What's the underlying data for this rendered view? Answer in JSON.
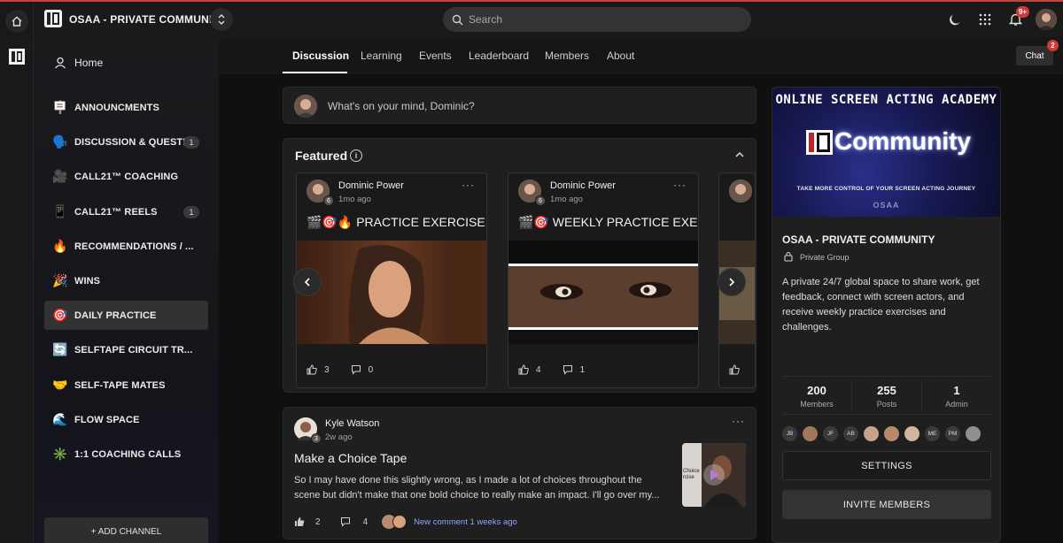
{
  "topbar": {
    "community_name": "OSAA - PRIVATE COMMUNITY",
    "search_placeholder": "Search",
    "notifications_badge": "9+",
    "chat_badge": "2"
  },
  "sidebar": {
    "home_label": "Home",
    "items": [
      {
        "emoji": "🪧",
        "label": "ANNOUNCMENTS",
        "count": ""
      },
      {
        "emoji": "🗣️",
        "label": "DISCUSSION & QUESTI...",
        "count": "1"
      },
      {
        "emoji": "🎥",
        "label": "CALL21™ COACHING",
        "count": ""
      },
      {
        "emoji": "📱",
        "label": "CALL21™ REELS",
        "count": "1"
      },
      {
        "emoji": "🔥",
        "label": "RECOMMENDATIONS / ...",
        "count": ""
      },
      {
        "emoji": "🎉",
        "label": "WINS",
        "count": ""
      },
      {
        "emoji": "🎯",
        "label": "DAILY PRACTICE",
        "count": ""
      },
      {
        "emoji": "🔄",
        "label": "SELFTAPE CIRCUIT TR...",
        "count": ""
      },
      {
        "emoji": "🤝",
        "label": "SELF-TAPE MATES",
        "count": ""
      },
      {
        "emoji": "🌊",
        "label": "FLOW SPACE",
        "count": ""
      },
      {
        "emoji": "✳️",
        "label": "1:1 COACHING CALLS",
        "count": ""
      }
    ],
    "add_channel": "+ ADD CHANNEL"
  },
  "tabs": [
    "Discussion",
    "Learning",
    "Events",
    "Leaderboard",
    "Members",
    "About"
  ],
  "chat_label": "Chat",
  "composer": {
    "placeholder": "What's on your mind, Dominic?"
  },
  "featured": {
    "title": "Featured",
    "posts": [
      {
        "author": "Dominic Power",
        "level": "6",
        "when": "1mo ago",
        "title_prefix": "🎬🎯🔥",
        "title": "PRACTICE EXERCISE",
        "likes": "3",
        "comments": "0"
      },
      {
        "author": "Dominic Power",
        "level": "6",
        "when": "1mo ago",
        "title_prefix": "🎬🎯",
        "title": "WEEKLY PRACTICE EXE...",
        "likes": "4",
        "comments": "1"
      }
    ]
  },
  "about": {
    "banner_heading": "ONLINE SCREEN ACTING ACADEMY",
    "banner_brand": "Community",
    "banner_tagline": "TAKE MORE CONTROL OF YOUR SCREEN ACTING JOURNEY",
    "banner_footer": "OSAA",
    "name": "OSAA - PRIVATE COMMUNITY",
    "privacy": "Private Group",
    "description": "A private 24/7 global space to share work, get feedback, connect with screen actors, and receive weekly practice exercises and challenges.",
    "stats": [
      {
        "value": "200",
        "label": "Members"
      },
      {
        "value": "255",
        "label": "Posts"
      },
      {
        "value": "1",
        "label": "Admin"
      }
    ],
    "member_initials": [
      "JB",
      "",
      "JF",
      "AB",
      "",
      "",
      "",
      "ME",
      "PM",
      ""
    ],
    "settings_label": "SETTINGS",
    "invite_label": "INVITE MEMBERS"
  },
  "feed": {
    "author": "Kyle Watson",
    "level": "3",
    "when": "2w ago",
    "title": "Make a Choice Tape",
    "body": "So I may have done this slightly wrong, as I made a lot of choices throughout the scene but didn't make that one bold choice to really make an impact. I'll go over my...",
    "thumb_text": "Choice rcise",
    "likes": "2",
    "comments": "4",
    "new_comment": "New comment 1 weeks ago"
  },
  "colors": {
    "accent_link": "#8ea6ff",
    "badge": "#d03a3a",
    "banner": "#181a55"
  }
}
